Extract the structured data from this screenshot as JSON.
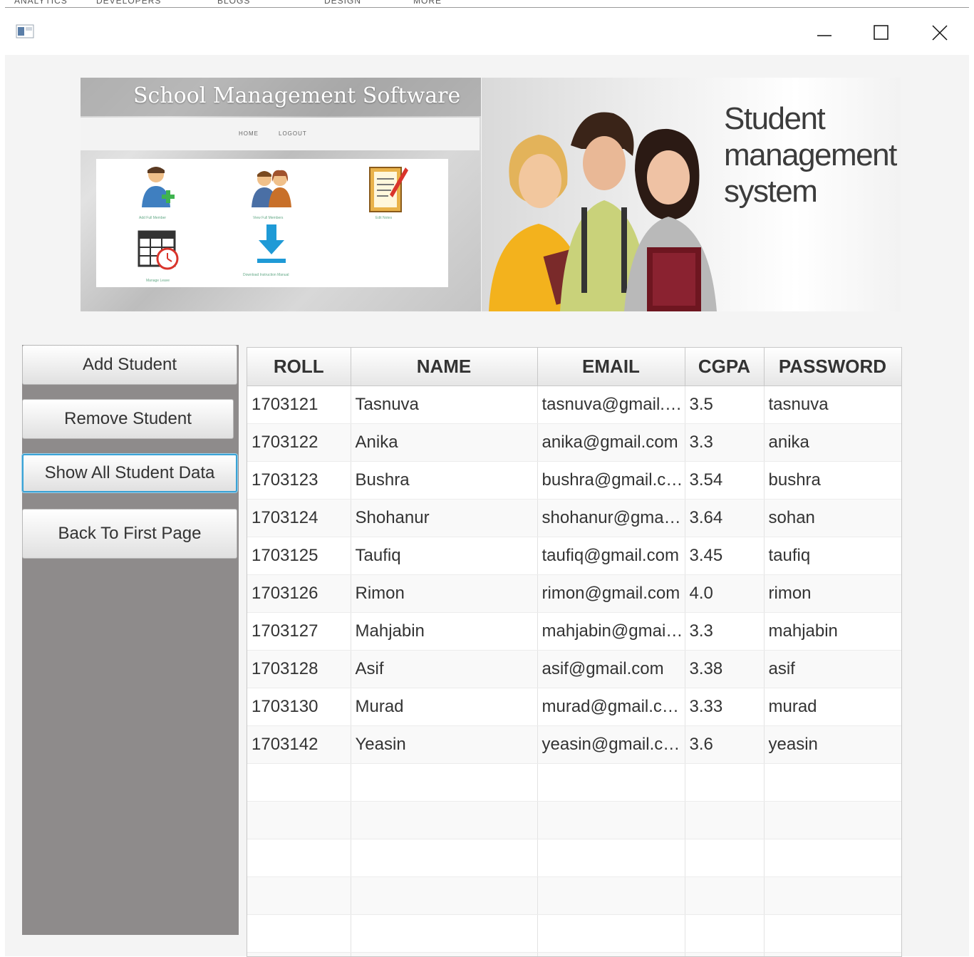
{
  "behind_window": {
    "menu_fragments": [
      "ANALYTICS",
      "DEVELOPERS",
      "BLOGS",
      "DESIGN",
      "MORE"
    ]
  },
  "window": {
    "icons": {
      "app": "java-app-icon",
      "minimize": "minimize-icon",
      "maximize": "maximize-icon",
      "close": "close-icon"
    }
  },
  "banner": {
    "left": {
      "title": "School Management Software",
      "nav": [
        "HOME",
        "LOGOUT"
      ],
      "tiles": [
        {
          "icon": "add-user-icon",
          "caption": "Add Full Member"
        },
        {
          "icon": "users-icon",
          "caption": "View Full Members"
        },
        {
          "icon": "edit-notes-icon",
          "caption": "Edit Notes"
        },
        {
          "icon": "calendar-icon",
          "caption": "Manage Leave"
        },
        {
          "icon": "download-icon",
          "caption": "Download Instruction Manual"
        }
      ]
    },
    "right": {
      "lines": [
        "Student",
        "management",
        "system"
      ]
    }
  },
  "sidebar": {
    "buttons": {
      "add": "Add Student",
      "remove": "Remove Student",
      "show": "Show All Student Data",
      "back": "Back To First Page"
    }
  },
  "table": {
    "columns": [
      "ROLL",
      "NAME",
      "EMAIL",
      "CGPA",
      "PASSWORD"
    ],
    "rows": [
      [
        "1703121",
        "Tasnuva",
        "tasnuva@gmail.com",
        "3.5",
        "tasnuva"
      ],
      [
        "1703122",
        "Anika",
        "anika@gmail.com",
        "3.3",
        "anika"
      ],
      [
        "1703123",
        "Bushra",
        "bushra@gmail.com",
        "3.54",
        "bushra"
      ],
      [
        "1703124",
        "Shohanur",
        "shohanur@gmail.c...",
        "3.64",
        "sohan"
      ],
      [
        "1703125",
        "Taufiq",
        "taufiq@gmail.com",
        "3.45",
        "taufiq"
      ],
      [
        "1703126",
        "Rimon",
        "rimon@gmail.com",
        "4.0",
        "rimon"
      ],
      [
        "1703127",
        "Mahjabin",
        "mahjabin@gmail.c...",
        "3.3",
        "mahjabin"
      ],
      [
        "1703128",
        "Asif",
        "asif@gmail.com",
        "3.38",
        "asif"
      ],
      [
        "1703130",
        "Murad",
        "murad@gmail.com",
        "3.33",
        "murad"
      ],
      [
        "1703142",
        "Yeasin",
        "yeasin@gmail.com",
        "3.6",
        "yeasin"
      ]
    ],
    "empty_rows": 6
  },
  "colors": {
    "sidebar_bg": "#8e8b8b",
    "focus_ring": "#3aa3d6",
    "window_bg": "#f4f4f4"
  }
}
